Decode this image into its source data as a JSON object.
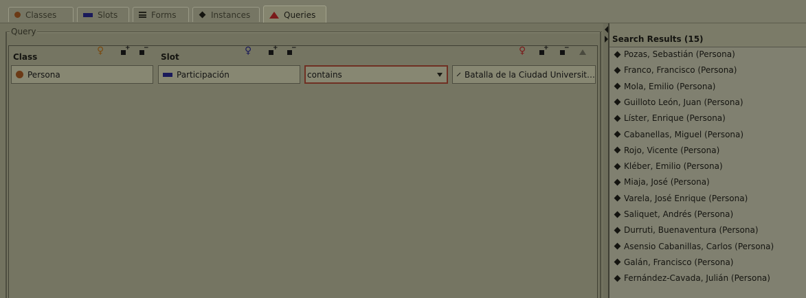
{
  "tabs": [
    {
      "label": "Classes",
      "icon": "class-circle-icon"
    },
    {
      "label": "Slots",
      "icon": "slot-bar-icon"
    },
    {
      "label": "Forms",
      "icon": "form-lines-icon"
    },
    {
      "label": "Instances",
      "icon": "instance-diamond-icon"
    },
    {
      "label": "Queries",
      "icon": "query-triangle-icon",
      "active": true
    }
  ],
  "query": {
    "legend": "Query",
    "class_header": "Class",
    "slot_header": "Slot",
    "class_value": "Persona",
    "slot_value": "Participación",
    "operator": "contains",
    "value": "Batalla de la Ciudad Universit…"
  },
  "results": {
    "title": "Search Results (15)",
    "items": [
      "Pozas, Sebastián  (Persona)",
      "Franco, Francisco  (Persona)",
      "Mola, Emilio  (Persona)",
      "Guilloto León, Juan  (Persona)",
      "Líster, Enrique  (Persona)",
      "Cabanellas, Miguel  (Persona)",
      "Rojo, Vicente  (Persona)",
      "Kléber, Emilio  (Persona)",
      "Miaja, José  (Persona)",
      "Varela, José Enrique  (Persona)",
      "Saliquet, Andrés  (Persona)",
      "Durruti, Buenaventura  (Persona)",
      "Asensio Cabanillas, Carlos  (Persona)",
      "Galán, Francisco  (Persona)",
      "Fernández-Cavada, Julián  (Persona)"
    ]
  },
  "colors": {
    "background": "#7a7a68",
    "class_icon": "#6b3a16",
    "slot_icon": "#1a1a5a",
    "query_icon": "#7a1a1a",
    "dropdown_border": "#6f2f22"
  }
}
